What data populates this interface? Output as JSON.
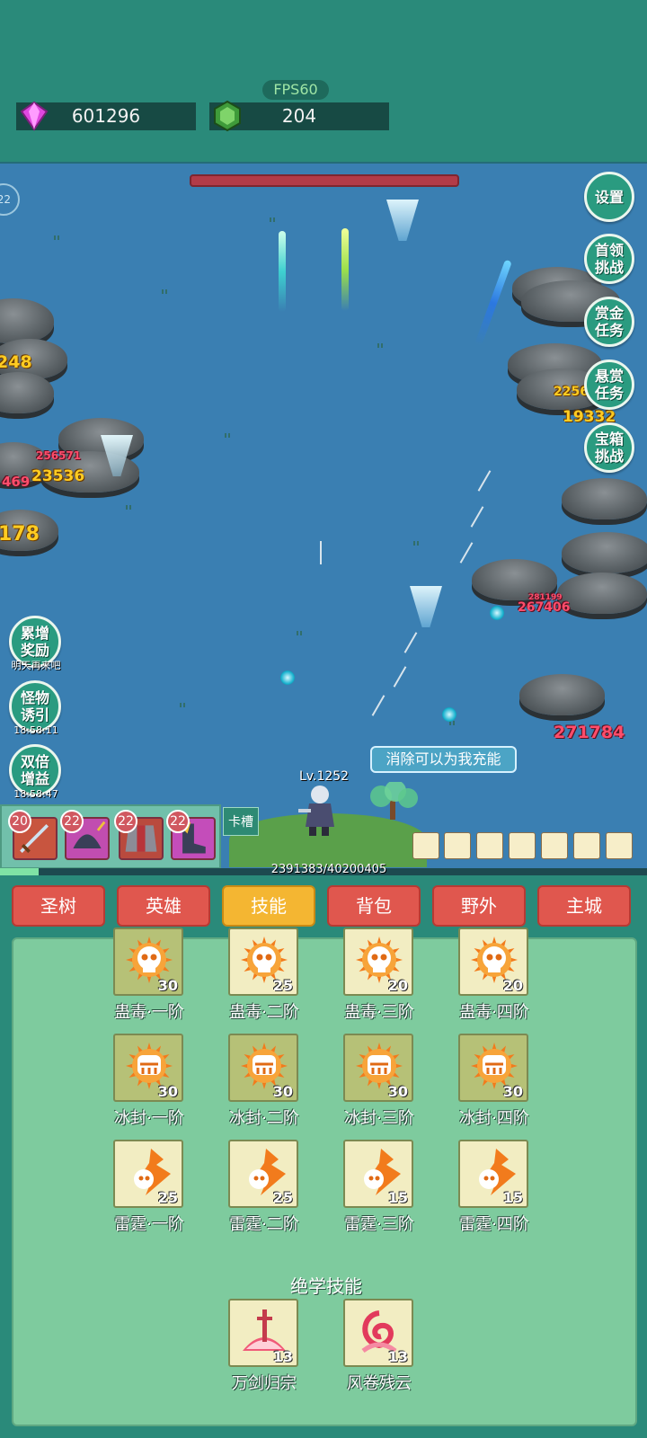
{
  "fps": "FPS60",
  "resources": {
    "gems": "601296",
    "crystals": "204"
  },
  "stage_counter": "22",
  "side_buttons_right": [
    {
      "label": "设置"
    },
    {
      "label": "首领挑战"
    },
    {
      "label": "赏金任务"
    },
    {
      "label": "悬赏任务"
    },
    {
      "label": "宝箱挑战"
    }
  ],
  "side_buttons_left": [
    {
      "label": "累增奖励",
      "sub": "明天再来吧"
    },
    {
      "label": "怪物诱引",
      "sub": "18:58:11"
    },
    {
      "label": "双倍增益",
      "sub": "18:58:47"
    }
  ],
  "damage_numbers": [
    "248",
    "256571",
    "23536",
    "469",
    "178",
    "2256",
    "19332",
    "281199",
    "267406",
    "271784"
  ],
  "hint": "消除可以为我充能",
  "player_level": "Lv.1252",
  "experience": {
    "text": "2391383/40200405",
    "progress": 0.0595
  },
  "slot_label": "卡槽",
  "equipment_slots": [
    {
      "level": "20",
      "color": "#c8553f"
    },
    {
      "level": "22",
      "color": "#c14db0"
    },
    {
      "level": "22",
      "color": "#b94a3e"
    },
    {
      "level": "22",
      "color": "#c44dba"
    }
  ],
  "tabs": [
    {
      "label": "圣树",
      "active": false
    },
    {
      "label": "英雄",
      "active": false
    },
    {
      "label": "技能",
      "active": true
    },
    {
      "label": "背包",
      "active": false
    },
    {
      "label": "野外",
      "active": false
    },
    {
      "label": "主城",
      "active": false
    }
  ],
  "skills": [
    {
      "name": "蛊毒·一阶",
      "level": "30",
      "icon": "skull-icon"
    },
    {
      "name": "蛊毒·二阶",
      "level": "25",
      "icon": "skull-icon"
    },
    {
      "name": "蛊毒·三阶",
      "level": "20",
      "icon": "skull-icon"
    },
    {
      "name": "蛊毒·四阶",
      "level": "20",
      "icon": "skull-icon"
    },
    {
      "name": "冰封·一阶",
      "level": "30",
      "icon": "frozen-skull-icon"
    },
    {
      "name": "冰封·二阶",
      "level": "30",
      "icon": "frozen-skull-icon"
    },
    {
      "name": "冰封·三阶",
      "level": "30",
      "icon": "frozen-skull-icon"
    },
    {
      "name": "冰封·四阶",
      "level": "30",
      "icon": "frozen-skull-icon"
    },
    {
      "name": "雷霆·一阶",
      "level": "25",
      "icon": "lightning-skull-icon"
    },
    {
      "name": "雷霆·二阶",
      "level": "25",
      "icon": "lightning-skull-icon"
    },
    {
      "name": "雷霆·三阶",
      "level": "15",
      "icon": "lightning-skull-icon"
    },
    {
      "name": "雷霆·四阶",
      "level": "15",
      "icon": "lightning-skull-icon"
    }
  ],
  "ultimate_title": "绝学技能",
  "ultimate_skills": [
    {
      "name": "万剑归宗",
      "level": "13",
      "icon": "sword-burst-icon"
    },
    {
      "name": "风卷残云",
      "level": "13",
      "icon": "whirlwind-icon"
    }
  ],
  "colors": {
    "background": "#2a8a7a",
    "battlefield": "#3a7fb2",
    "tab": "#e0574e",
    "tab_active": "#f4b632",
    "panel": "#7ecb9e"
  }
}
